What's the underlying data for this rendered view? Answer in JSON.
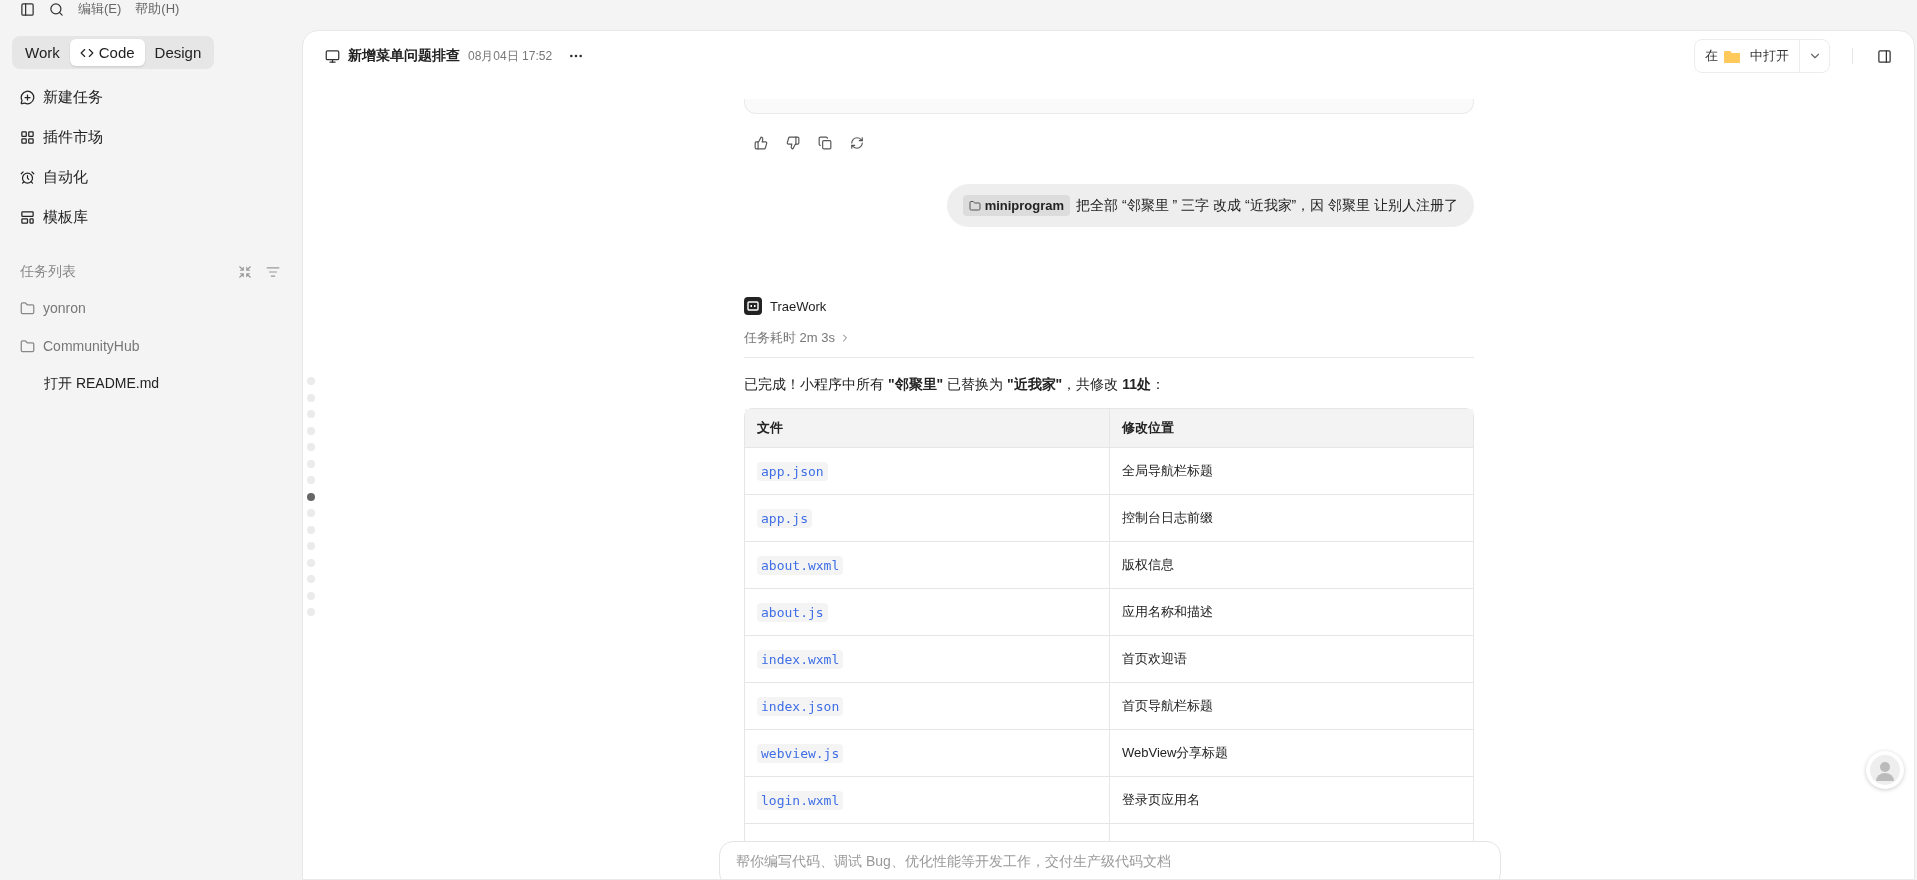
{
  "menu": [
    "编辑(E)",
    "帮助(H)"
  ],
  "modes": [
    {
      "label": "Work",
      "selected": false,
      "kind": "text"
    },
    {
      "label": "Code",
      "selected": true,
      "kind": "code"
    },
    {
      "label": "Design",
      "selected": false,
      "kind": "text"
    }
  ],
  "nav": [
    {
      "label": "新建任务",
      "kind": "new"
    },
    {
      "label": "插件市场",
      "kind": "plugins"
    },
    {
      "label": "自动化",
      "kind": "clock"
    },
    {
      "label": "模板库",
      "kind": "template"
    }
  ],
  "task_list": {
    "title": "任务列表",
    "items": [
      {
        "label": "yonron",
        "kind": "folder"
      },
      {
        "label": "CommunityHub",
        "kind": "folder"
      },
      {
        "label": "打开 README.md",
        "kind": "file"
      }
    ]
  },
  "header": {
    "title": "新增菜单问题排查",
    "time": "08月04日 17:52",
    "open_in": {
      "before": "在",
      "after": "中打开"
    }
  },
  "timeline": [
    {
      "selected": false
    },
    {
      "selected": false
    },
    {
      "selected": false
    },
    {
      "selected": false
    },
    {
      "selected": false
    },
    {
      "selected": false
    },
    {
      "selected": false
    },
    {
      "selected": true
    },
    {
      "selected": false
    },
    {
      "selected": false
    },
    {
      "selected": false
    },
    {
      "selected": false
    },
    {
      "selected": false
    },
    {
      "selected": false
    },
    {
      "selected": false
    }
  ],
  "user_message": {
    "chip": "miniprogram",
    "text": "把全部 “邻聚里 ” 三字 改成 “近我家”，因 邻聚里 让别人注册了"
  },
  "reply": {
    "author": "TraeWork",
    "duration": "任务耗时 2m 3s",
    "summary": "已完成！小程序中所有 **\"邻聚里\"** 已替换为 **\"近我家\"**，共修改 **11处**："
  },
  "table": {
    "columns": [
      "文件",
      "修改位置"
    ],
    "rows": [
      [
        "app.json",
        "全局导航栏标题"
      ],
      [
        "app.js",
        "控制台日志前缀"
      ],
      [
        "about.wxml",
        "版权信息"
      ],
      [
        "about.js",
        "应用名称和描述"
      ],
      [
        "index.wxml",
        "首页欢迎语"
      ],
      [
        "index.json",
        "首页导航栏标题"
      ],
      [
        "webview.js",
        "WebView分享标题"
      ],
      [
        "login.wxml",
        "登录页应用名"
      ]
    ]
  },
  "composer": {
    "placeholder": "帮你编写代码、调试 Bug、优化性能等开发工作，交付生产级代码文档"
  }
}
